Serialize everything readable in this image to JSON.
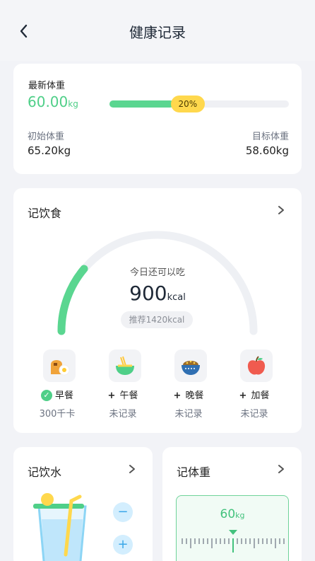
{
  "header": {
    "title": "健康记录"
  },
  "weight": {
    "latest_label": "最新体重",
    "latest_value": "60.00",
    "latest_unit": "kg",
    "progress": 0.2,
    "progress_label": "20%",
    "initial_label": "初始体重",
    "initial_value": "65.20kg",
    "target_label": "目标体重",
    "target_value": "58.60kg"
  },
  "diet": {
    "title": "记饮食",
    "remain_label": "今日还可以吃",
    "remain_value": "900",
    "remain_unit": "kcal",
    "recommend": "推荐1420kcal",
    "meals": [
      {
        "name": "早餐",
        "status": "300千卡",
        "done": true,
        "icon": "toast-icon"
      },
      {
        "name": "午餐",
        "status": "未记录",
        "done": false,
        "icon": "noodle-bowl-icon"
      },
      {
        "name": "晚餐",
        "status": "未记录",
        "done": false,
        "icon": "rice-bowl-icon"
      },
      {
        "name": "加餐",
        "status": "未记录",
        "done": false,
        "icon": "apple-icon"
      }
    ]
  },
  "water": {
    "title": "记饮水",
    "minus": "−",
    "plus": "+"
  },
  "bodyweight": {
    "title": "记体重",
    "value": "60",
    "unit": "kg"
  },
  "colors": {
    "accent": "#4fcf88",
    "badge": "#ffd84d",
    "water": "#3aa7e8"
  }
}
